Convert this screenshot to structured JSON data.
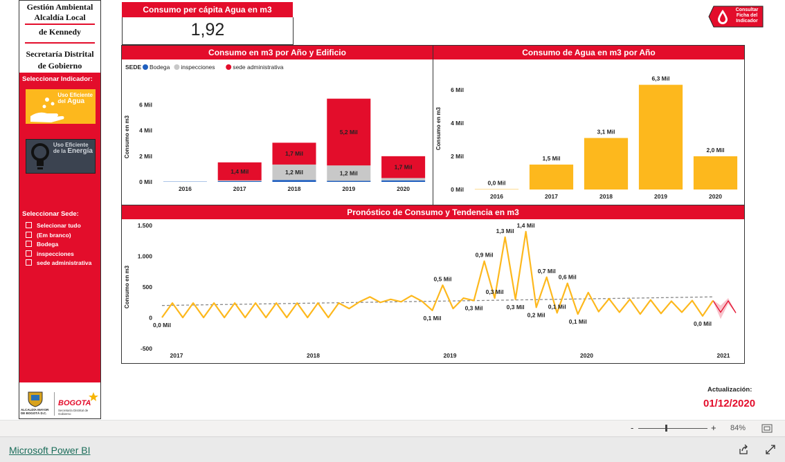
{
  "left": {
    "title_line1": "Gestión Ambiental",
    "title_line2": "Alcaldía Local",
    "title_line3": "de Kennedy",
    "subtitle_line1": "Secretaría Distrital",
    "subtitle_line2": "de Gobierno",
    "select_indicator_label": "Seleccionar Indicador:",
    "indicator_water": {
      "line1": "Uso Eficiente",
      "line2": "del",
      "line3": "Agua"
    },
    "indicator_energy": {
      "line1": "Uso Eficiente",
      "line2": "de la",
      "line3": "Energía"
    },
    "select_sede_label": "Seleccionar Sede:",
    "sede_options": [
      "Selecionar tudo",
      "(Em branco)",
      "Bodega",
      "inspecciones",
      "sede administrativa"
    ],
    "logo_left_text1": "ALCALDÍA MAYOR",
    "logo_left_text2": "DE BOGOTÁ D.C.",
    "logo_right_text": "BOGOTA",
    "logo_right_sub1": "Secretaría Distrital de",
    "logo_right_sub2": "Gobierno"
  },
  "kpi": {
    "title": "Consumo per cápita Agua en m3",
    "value": "1,92"
  },
  "consult_button": {
    "line1": "Consultar",
    "line2": "Ficha del",
    "line3": "Indicador"
  },
  "colors": {
    "red": "#e30d2b",
    "yellow": "#fdb81d",
    "blue": "#1f5fbf",
    "grey": "#c8c8c8"
  },
  "chart_data": [
    {
      "type": "bar",
      "title": "Consumo en m3 por Año y Edificio",
      "legend_title": "SEDE",
      "ylabel": "Consumo en m3",
      "categories": [
        "2016",
        "2017",
        "2018",
        "2019",
        "2020"
      ],
      "y_ticks": [
        "0 Mil",
        "2 Mil",
        "4 Mil",
        "6 Mil"
      ],
      "ylim": [
        0,
        7000
      ],
      "series": [
        {
          "name": "Bodega",
          "values": [
            20,
            60,
            150,
            80,
            120
          ],
          "labels": [
            "",
            "",
            "",
            "",
            ""
          ]
        },
        {
          "name": "inspecciones",
          "values": [
            0,
            60,
            1200,
            1200,
            180
          ],
          "labels": [
            "",
            "",
            "1,2 Mil",
            "1,2 Mil",
            ""
          ]
        },
        {
          "name": "sede administrativa",
          "values": [
            0,
            1400,
            1700,
            5200,
            1700
          ],
          "labels": [
            "",
            "1,4 Mil",
            "1,7 Mil",
            "5,2 Mil",
            "1,7 Mil"
          ]
        }
      ]
    },
    {
      "type": "bar",
      "title": "Consumo de Agua en m3 por Año",
      "ylabel": "Consumo en m3",
      "categories": [
        "2016",
        "2017",
        "2018",
        "2019",
        "2020"
      ],
      "values": [
        20,
        1500,
        3100,
        6300,
        2000
      ],
      "labels": [
        "0,0 Mil",
        "1,5 Mil",
        "3,1 Mil",
        "6,3 Mil",
        "2,0 Mil"
      ],
      "y_ticks": [
        "0 Mil",
        "2 Mil",
        "4 Mil",
        "6 Mil"
      ],
      "ylim": [
        0,
        6700
      ]
    },
    {
      "type": "line",
      "title": "Pronóstico de Consumo y Tendencia en m3",
      "ylabel": "Consumo en m3",
      "x_ticks": [
        "2017",
        "2018",
        "2019",
        "2020",
        "2021"
      ],
      "y_ticks": [
        "1.500",
        "1.000",
        "500",
        "0",
        "-500"
      ],
      "ylim": [
        -500,
        1500
      ],
      "values": [
        5,
        240,
        5,
        240,
        5,
        240,
        5,
        240,
        5,
        240,
        5,
        240,
        5,
        240,
        5,
        240,
        5,
        240,
        150,
        260,
        340,
        250,
        300,
        260,
        360,
        270,
        120,
        530,
        150,
        320,
        280,
        920,
        320,
        1310,
        300,
        1400,
        170,
        660,
        80,
        560,
        60,
        410,
        100,
        310,
        90,
        300,
        60,
        290,
        70,
        270,
        90,
        280,
        30,
        280
      ],
      "point_labels": [
        {
          "i": 0,
          "text": "0,0 Mil",
          "pos": "below"
        },
        {
          "i": 27,
          "text": "0,5 Mil",
          "pos": "above"
        },
        {
          "i": 26,
          "text": "0,1 Mil",
          "pos": "below"
        },
        {
          "i": 31,
          "text": "0,9 Mil",
          "pos": "above"
        },
        {
          "i": 30,
          "text": "0,3 Mil",
          "pos": "below"
        },
        {
          "i": 33,
          "text": "1,3 Mil",
          "pos": "above"
        },
        {
          "i": 32,
          "text": "0,3 Mil",
          "pos": "above"
        },
        {
          "i": 35,
          "text": "1,4 Mil",
          "pos": "above"
        },
        {
          "i": 34,
          "text": "0,3 Mil",
          "pos": "below"
        },
        {
          "i": 37,
          "text": "0,7 Mil",
          "pos": "above"
        },
        {
          "i": 36,
          "text": "0,2 Mil",
          "pos": "below"
        },
        {
          "i": 39,
          "text": "0,6 Mil",
          "pos": "above"
        },
        {
          "i": 38,
          "text": "0,1 Mil",
          "pos": "above"
        },
        {
          "i": 40,
          "text": "0,1 Mil",
          "pos": "below"
        },
        {
          "i": 52,
          "text": "0,0 Mil",
          "pos": "below"
        }
      ],
      "trend": {
        "start": 200,
        "end": 340
      },
      "forecast": {
        "values": [
          280,
          90,
          275,
          80
        ]
      }
    }
  ],
  "update": {
    "label": "Actualización:",
    "date": "01/12/2020"
  },
  "zoom": {
    "minus": "-",
    "plus": "+",
    "percent": "84%"
  },
  "footer": {
    "brand": "Microsoft Power BI"
  }
}
